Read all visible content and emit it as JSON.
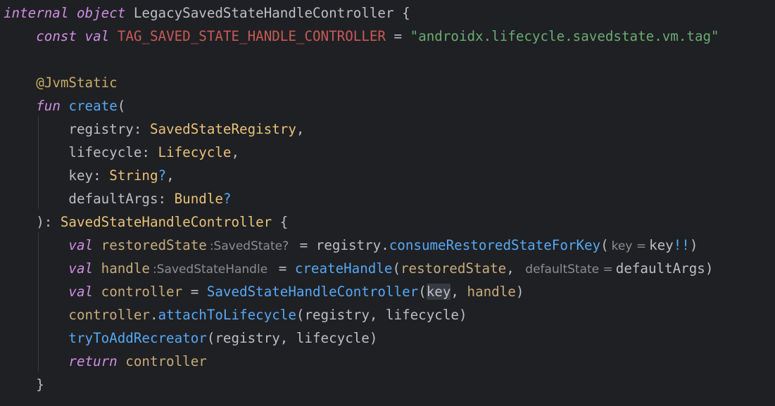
{
  "editor": {
    "lines": [
      {
        "internal": "internal",
        "object": "object",
        "name": "LegacySavedStateHandleController",
        "brace": " {"
      },
      {
        "const": "const",
        "val": "val",
        "tag": "TAG_SAVED_STATE_HANDLE_CONTROLLER",
        "eq": " = ",
        "str": "\"androidx.lifecycle.savedstate.vm.tag\""
      },
      {},
      {
        "annotation": "@JvmStatic"
      },
      {
        "fun": "fun",
        "name": "create",
        "paren": "("
      },
      {
        "param": "registry",
        "colon": ": ",
        "type": "SavedStateRegistry",
        "comma": ","
      },
      {
        "param": "lifecycle",
        "colon": ": ",
        "type": "Lifecycle",
        "comma": ","
      },
      {
        "param": "key",
        "colon": ": ",
        "type": "String",
        "q": "?",
        "comma": ","
      },
      {
        "param": "defaultArgs",
        "colon": ": ",
        "type": "Bundle",
        "q": "?"
      },
      {
        "close": "): ",
        "type": "SavedStateHandleController",
        "brace": " {"
      },
      {
        "val": "val",
        "name": "restoredState",
        "hint": ":SavedState?",
        "eq": " = ",
        "recv": "registry",
        "dot": ".",
        "call": "consumeRestoredStateForKey",
        "open": "(",
        "argHint": "key =",
        "arg": "key",
        "bang": "!!",
        "close": ")"
      },
      {
        "val": "val",
        "name": "handle",
        "hint": ":SavedStateHandle",
        "eq": " = ",
        "call": "createHandle",
        "open": "(",
        "arg1": "restoredState",
        "comma": ", ",
        "argHint": "defaultState =",
        "arg2": "defaultArgs",
        "close": ")"
      },
      {
        "val": "val",
        "name": "controller",
        "eq": " = ",
        "call": "SavedStateHandleController",
        "open": "(",
        "arg1": "key",
        "comma": ", ",
        "arg2": "handle",
        "close": ")"
      },
      {
        "recv": "controller",
        "dot": ".",
        "call": "attachToLifecycle",
        "args": "(registry, lifecycle)"
      },
      {
        "call": "tryToAddRecreator",
        "args": "(registry, lifecycle)"
      },
      {
        "ret": "return",
        "value": "controller"
      },
      {
        "close": "}"
      }
    ]
  }
}
